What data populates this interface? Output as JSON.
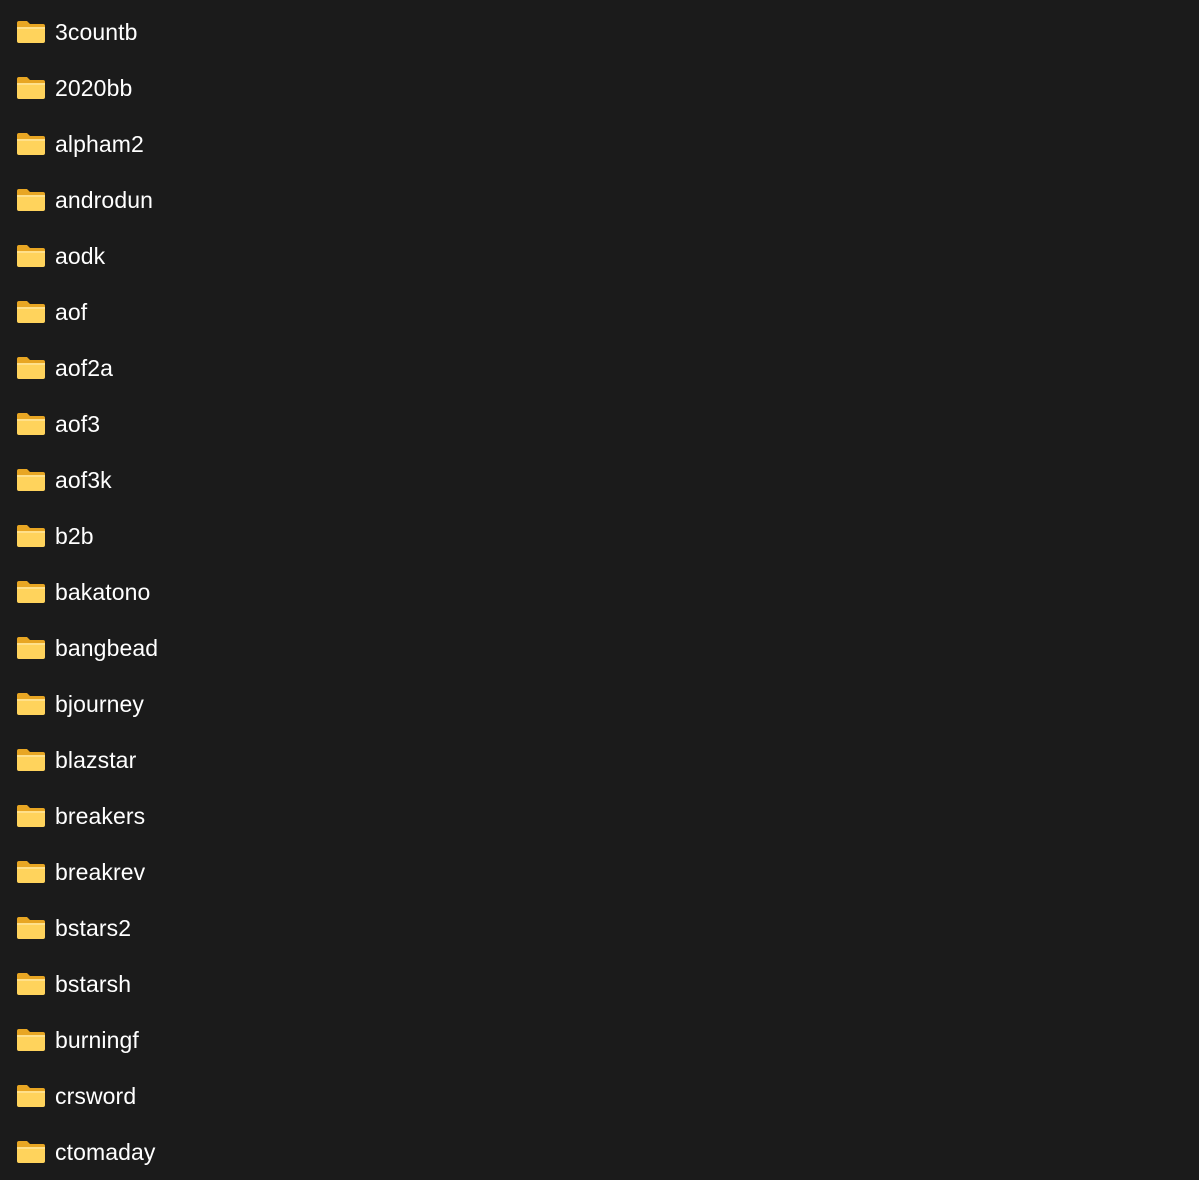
{
  "folders": [
    {
      "name": "3countb",
      "icon": "folder-icon"
    },
    {
      "name": "2020bb",
      "icon": "folder-icon"
    },
    {
      "name": "alpham2",
      "icon": "folder-icon"
    },
    {
      "name": "androdun",
      "icon": "folder-icon"
    },
    {
      "name": "aodk",
      "icon": "folder-icon"
    },
    {
      "name": "aof",
      "icon": "folder-icon"
    },
    {
      "name": "aof2a",
      "icon": "folder-icon"
    },
    {
      "name": "aof3",
      "icon": "folder-icon"
    },
    {
      "name": "aof3k",
      "icon": "folder-icon"
    },
    {
      "name": "b2b",
      "icon": "folder-icon"
    },
    {
      "name": "bakatono",
      "icon": "folder-icon"
    },
    {
      "name": "bangbead",
      "icon": "folder-icon"
    },
    {
      "name": "bjourney",
      "icon": "folder-icon"
    },
    {
      "name": "blazstar",
      "icon": "folder-icon"
    },
    {
      "name": "breakers",
      "icon": "folder-icon"
    },
    {
      "name": "breakrev",
      "icon": "folder-icon"
    },
    {
      "name": "bstars2",
      "icon": "folder-icon"
    },
    {
      "name": "bstarsh",
      "icon": "folder-icon"
    },
    {
      "name": "burningf",
      "icon": "folder-icon"
    },
    {
      "name": "crsword",
      "icon": "folder-icon"
    },
    {
      "name": "ctomaday",
      "icon": "folder-icon"
    }
  ],
  "colors": {
    "background": "#1b1b1b",
    "text": "#ffffff",
    "folder_front": "#ffd35c",
    "folder_back": "#e8a623"
  }
}
